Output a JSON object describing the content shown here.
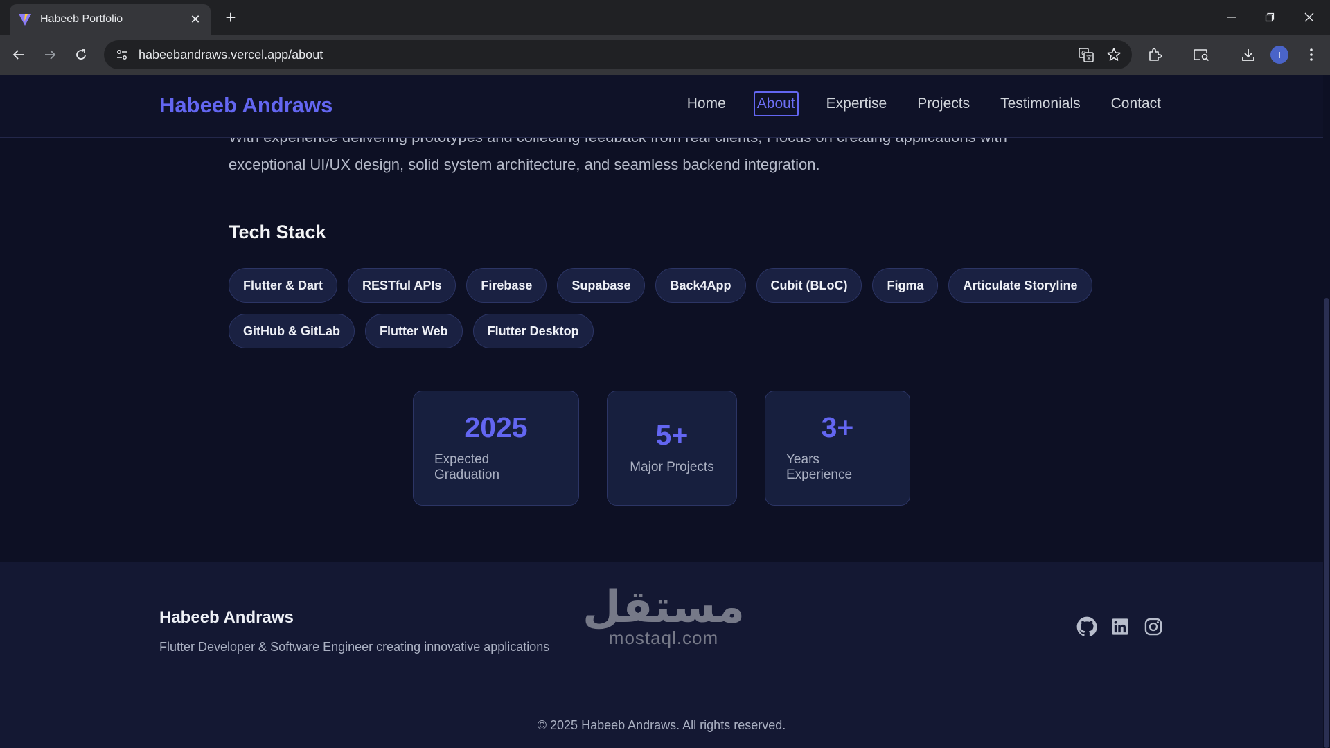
{
  "browser": {
    "tab_title": "Habeeb Portfolio",
    "url_host": "habeebandraws.vercel.app",
    "url_path": "/about",
    "profile_initial": "I"
  },
  "site": {
    "brand": "Habeeb Andraws",
    "nav": [
      "Home",
      "About",
      "Expertise",
      "Projects",
      "Testimonials",
      "Contact"
    ],
    "active_nav": "About"
  },
  "about": {
    "intro_partial": "With experience delivering prototypes and collecting feedback from real clients, I focus on creating applications with",
    "intro": "exceptional UI/UX design, solid system architecture, and seamless backend integration.",
    "tech_heading": "Tech Stack",
    "tech_stack": [
      "Flutter & Dart",
      "RESTful APIs",
      "Firebase",
      "Supabase",
      "Back4App",
      "Cubit (BLoC)",
      "Figma",
      "Articulate Storyline",
      "GitHub & GitLab",
      "Flutter Web",
      "Flutter Desktop"
    ],
    "stats": [
      {
        "value": "2025",
        "label": "Expected Graduation"
      },
      {
        "value": "5+",
        "label": "Major Projects"
      },
      {
        "value": "3+",
        "label": "Years Experience"
      }
    ]
  },
  "footer": {
    "brand": "Habeeb Andraws",
    "tagline": "Flutter Developer & Software Engineer creating innovative applications",
    "copyright": "© 2025 Habeeb Andraws. All rights reserved.",
    "socials": [
      "github-icon",
      "linkedin-icon",
      "instagram-icon"
    ]
  },
  "watermark": {
    "arabic": "مستقل",
    "latin": "mostaql.com"
  },
  "colors": {
    "accent": "#6366f1",
    "background": "#0d1024",
    "card": "#171f3e"
  }
}
